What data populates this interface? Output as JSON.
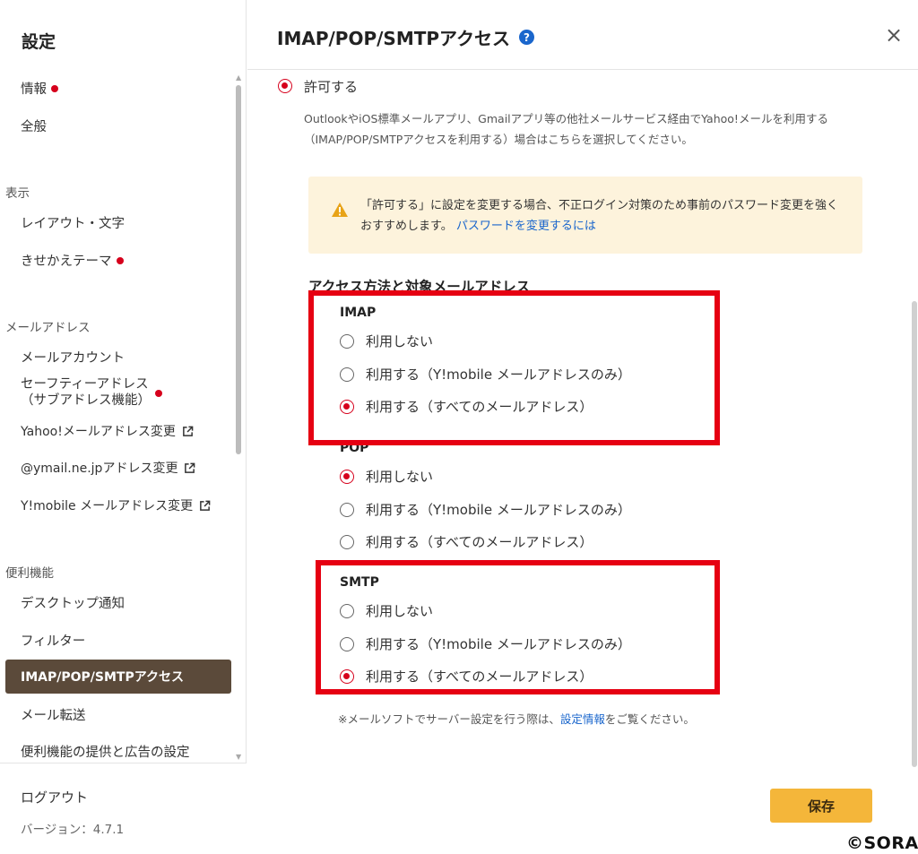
{
  "sidebar": {
    "title": "設定",
    "items": [
      {
        "label": "情報",
        "dot": true
      },
      {
        "label": "全般"
      },
      {
        "label": "レイアウト・文字"
      },
      {
        "label": "きせかえテーマ",
        "dot": true
      },
      {
        "label": "メールアカウント"
      },
      {
        "label": "セーフティーアドレス",
        "label2": "（サブアドレス機能）",
        "dot": true
      },
      {
        "label": "Yahoo!メールアドレス変更",
        "external": true
      },
      {
        "label": "@ymail.ne.jpアドレス変更",
        "external": true
      },
      {
        "label": "Y!mobile メールアドレス変更",
        "external": true
      },
      {
        "label": "デスクトップ通知"
      },
      {
        "label": "フィルター"
      },
      {
        "label": "IMAP/POP/SMTPアクセス",
        "active": true
      },
      {
        "label": "メール転送"
      },
      {
        "label": "便利機能の提供と広告の設定"
      }
    ],
    "sections": {
      "display": "表示",
      "mail_address": "メールアドレス",
      "utilities": "便利機能"
    },
    "logout": "ログアウト",
    "version": "バージョン：4.7.1"
  },
  "main": {
    "title": "IMAP/POP/SMTPアクセス",
    "help_glyph": "?",
    "close_glyph": "×",
    "allow": {
      "label": "許可する",
      "checked": true
    },
    "description": "OutlookやiOS標準メールアプリ、Gmailアプリ等の他社メールサービス経由でYahoo!メールを利用する（IMAP/POP/SMTPアクセスを利用する）場合はこちらを選択してください。",
    "warning": {
      "text": "「許可する」に設定を変更する場合、不正ログイン対策のため事前のパスワード変更を強くおすすめします。",
      "link": "パスワードを変更するには"
    },
    "access_heading": "アクセス方法と対象メールアドレス",
    "groups": [
      {
        "name": "IMAP",
        "options": [
          {
            "label": "利用しない",
            "checked": false
          },
          {
            "label": "利用する（Y!mobile メールアドレスのみ）",
            "checked": false
          },
          {
            "label": "利用する（すべてのメールアドレス）",
            "checked": true
          }
        ]
      },
      {
        "name": "POP",
        "options": [
          {
            "label": "利用しない",
            "checked": true
          },
          {
            "label": "利用する（Y!mobile メールアドレスのみ）",
            "checked": false
          },
          {
            "label": "利用する（すべてのメールアドレス）",
            "checked": false
          }
        ]
      },
      {
        "name": "SMTP",
        "options": [
          {
            "label": "利用しない",
            "checked": false
          },
          {
            "label": "利用する（Y!mobile メールアドレスのみ）",
            "checked": false
          },
          {
            "label": "利用する（すべてのメールアドレス）",
            "checked": true
          }
        ]
      }
    ],
    "note": {
      "prefix": "※メールソフトでサーバー設定を行う際は、",
      "link": "設定情報",
      "suffix": "をご覧ください。"
    },
    "save": "保存"
  },
  "watermark": "©SORA",
  "colors": {
    "accent_red": "#d6001c",
    "highlight_box": "#e60012",
    "active_nav": "#5b4a3a",
    "save_button": "#f4b63a",
    "warning_bg": "#fdf3dc",
    "link": "#1a66cc"
  }
}
